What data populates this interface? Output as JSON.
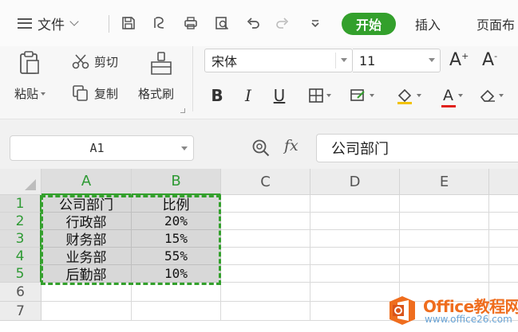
{
  "menubar": {
    "file_label": "文件",
    "tabs": [
      "开始",
      "插入",
      "页面布"
    ]
  },
  "ribbon": {
    "paste_label": "粘贴",
    "cut_label": "剪切",
    "copy_label": "复制",
    "format_painter_label": "格式刷",
    "font_name": "宋体",
    "font_size": "11",
    "increase_font_label": "A",
    "increase_font_mark": "+",
    "decrease_font_label": "A",
    "decrease_font_mark": "-",
    "bold_label": "B",
    "italic_label": "I",
    "underline_label": "U",
    "font_color_label": "A",
    "colors": {
      "accent": "#33a02c",
      "font_color_bar": "#e0201b",
      "fill_color_bar": "#f2c200"
    }
  },
  "formula_bar": {
    "name_box": "A1",
    "fx_label": "fx",
    "content": "公司部门"
  },
  "sheet": {
    "columns": [
      "A",
      "B",
      "C",
      "D",
      "E"
    ],
    "rows": [
      "1",
      "2",
      "3",
      "4",
      "5",
      "6",
      "7"
    ],
    "cells": [
      [
        "公司部门",
        "比例"
      ],
      [
        "行政部",
        "20%"
      ],
      [
        "财务部",
        "15%"
      ],
      [
        "业务部",
        "55%"
      ],
      [
        "后勤部",
        "10%"
      ]
    ]
  },
  "watermark": {
    "title": "Office教程网",
    "url": "www.office26.com"
  }
}
